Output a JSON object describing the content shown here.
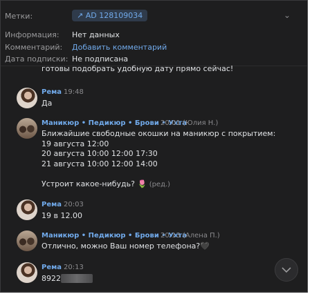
{
  "info": {
    "tags_label": "Метки:",
    "tag_value": "↗ AD 128109034",
    "info_label": "Информация:",
    "info_value": "Нет данных",
    "comment_label": "Комментарий:",
    "comment_link": "Добавить комментарий",
    "subscription_label": "Дата подписки:",
    "subscription_value": "Не подписана"
  },
  "cut_message": "готовы подобрать удобную дату прямо сейчас!",
  "messages": [
    {
      "sender": "Рема",
      "time": "19:48",
      "lines": [
        "Да"
      ]
    },
    {
      "sender": "Маникюр • Педикюр • Брови • Ухта",
      "time": "20:01 (Юлия Н.)",
      "lines": [
        "Ближайшие свободные окошки на маникюр с покрытием:",
        "19 августа 12:00",
        "20 августа 10:00 12:00 17:30",
        "21 августа 10:00 12:00 14:00"
      ],
      "extra": "Устроит какое-нибудь? 🌷",
      "edited": "(ред.)"
    },
    {
      "sender": "Рема",
      "time": "20:03",
      "lines": [
        "19 в 12.00"
      ]
    },
    {
      "sender": "Маникюр • Педикюр • Брови • Ухта",
      "time": "20:13 (Алена П.)",
      "lines": [
        "Отлично, можно Ваш номер телефона?🖤"
      ]
    },
    {
      "sender": "Рема",
      "time": "20:13",
      "lines": [
        "8922"
      ]
    }
  ]
}
